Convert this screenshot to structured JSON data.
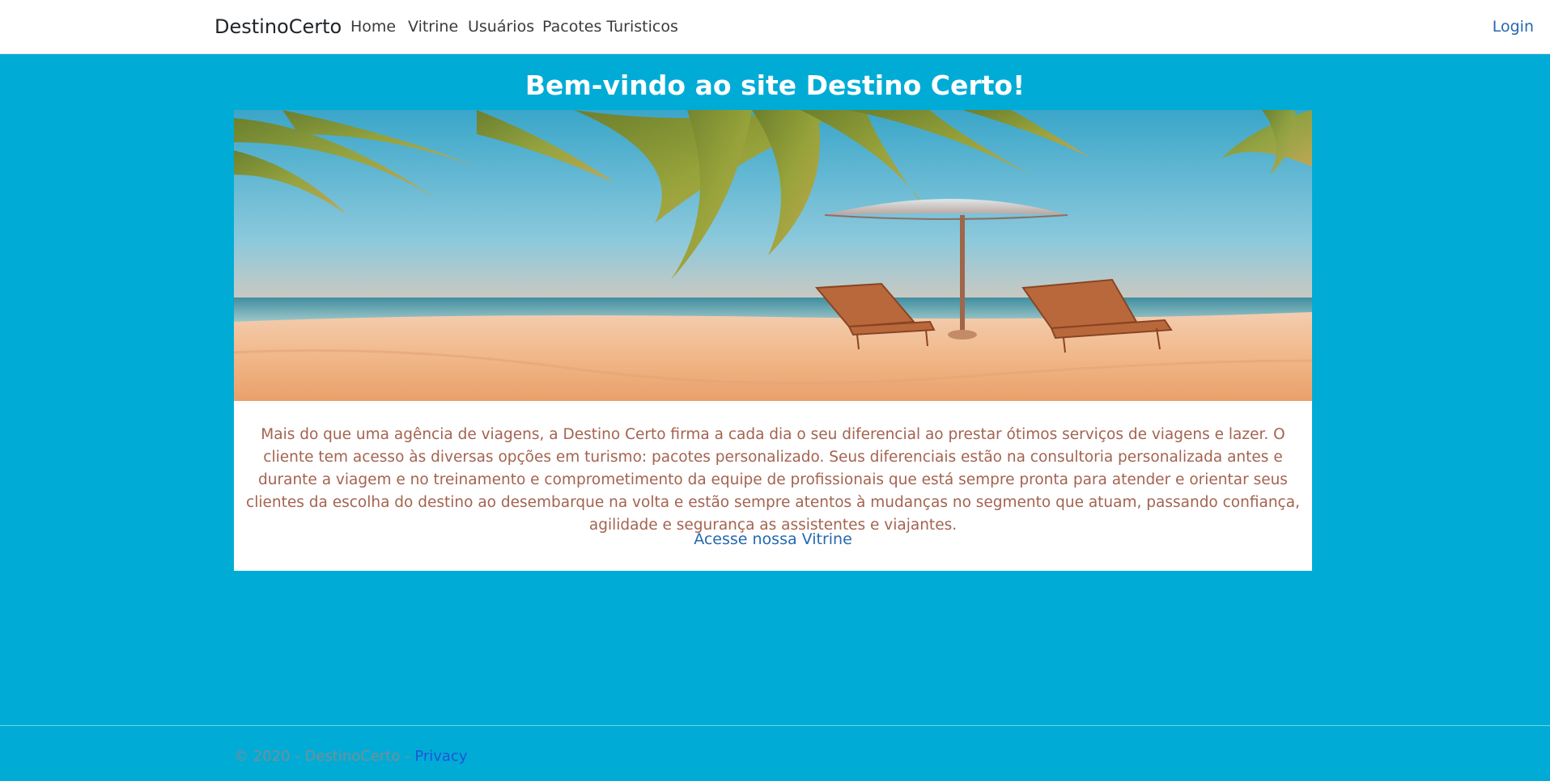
{
  "navbar": {
    "brand": "DestinoCerto",
    "links": [
      "Home",
      "Vitrine",
      "Usuários",
      "Pacotes Turisticos"
    ],
    "login": "Login"
  },
  "main": {
    "title": "Bem-vindo ao site Destino Certo!",
    "hero_image": "beach-umbrella-loungers-image",
    "description": "Mais do que uma agência de viagens, a Destino Certo firma a cada dia o seu diferencial ao prestar ótimos serviços de viagens e lazer. O cliente tem acesso às diversas opções em turismo: pacotes personalizado. Seus diferenciais estão na consultoria personalizada antes e durante a viagem e no treinamento e comprometimento da equipe de profissionais que está sempre pronta para atender e orientar seus clientes da escolha do destino ao desembarque na volta e estão sempre atentos à mudanças no segmento que atuam, passando confiança, agilidade e segurança as assistentes e viajantes.",
    "cta": "Acesse nossa Vitrine"
  },
  "footer": {
    "copyright": "© 2020 - DestinoCerto - ",
    "privacy": "Privacy"
  },
  "colors": {
    "page_background": "#00acd5",
    "link": "#2468b0",
    "description_text": "#a4634f"
  }
}
